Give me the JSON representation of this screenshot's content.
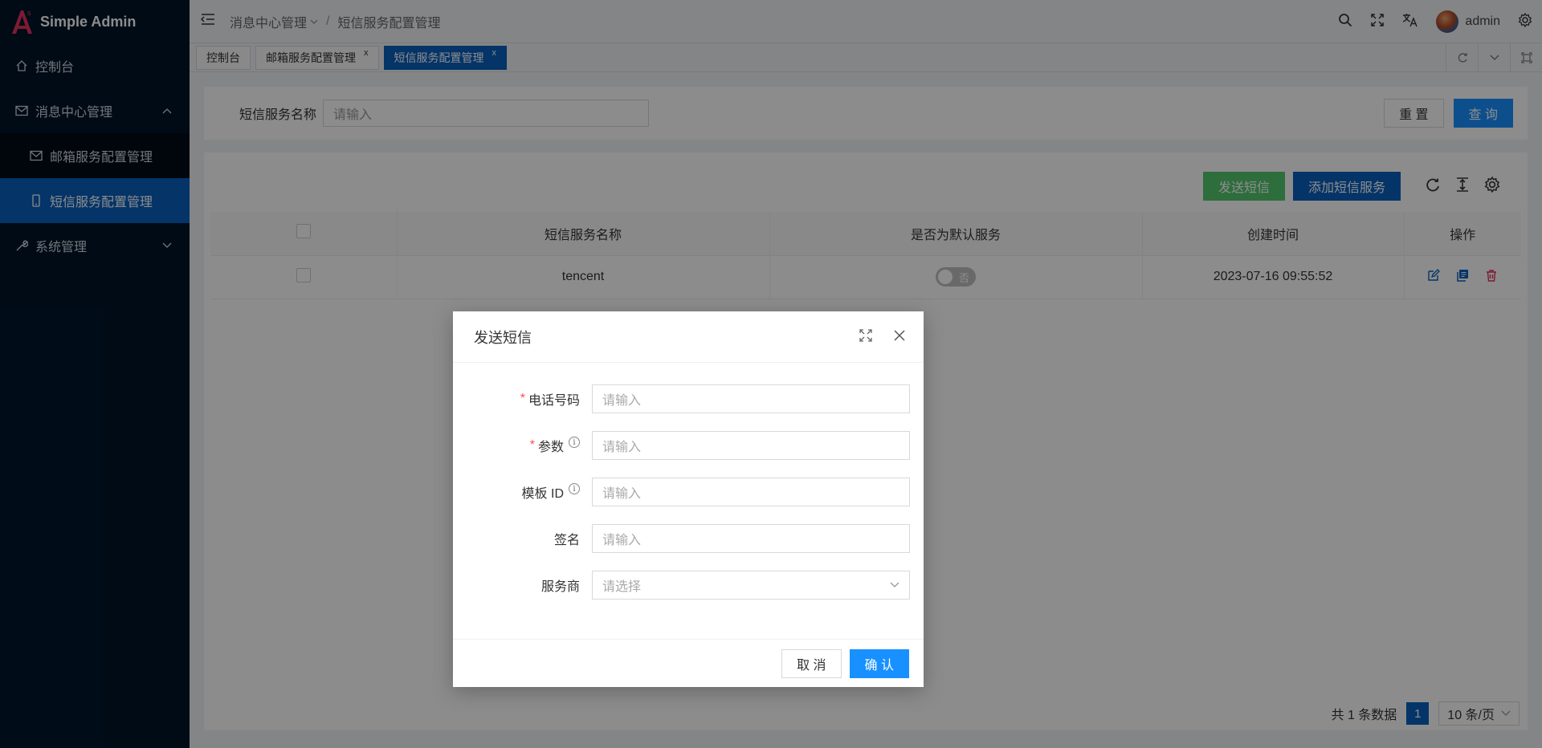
{
  "app": {
    "title": "Simple Admin"
  },
  "sidebar": {
    "items": [
      {
        "label": "控制台",
        "icon": "home-icon"
      },
      {
        "label": "消息中心管理",
        "icon": "mail-icon",
        "expanded": true,
        "children": [
          {
            "label": "邮箱服务配置管理",
            "icon": "mail-icon"
          },
          {
            "label": "短信服务配置管理",
            "icon": "phone-icon",
            "active": true
          }
        ]
      },
      {
        "label": "系统管理",
        "icon": "wrench-icon",
        "expanded": false
      }
    ]
  },
  "header": {
    "breadcrumb": [
      "消息中心管理",
      "短信服务配置管理"
    ],
    "user": "admin"
  },
  "tabs": [
    {
      "label": "控制台"
    },
    {
      "label": "邮箱服务配置管理",
      "close": "x"
    },
    {
      "label": "短信服务配置管理",
      "close": "x",
      "active": true
    }
  ],
  "search": {
    "label": "短信服务名称",
    "placeholder": "请输入",
    "reset_label": "重 置",
    "query_label": "查 询"
  },
  "toolbar": {
    "send_label": "发送短信",
    "add_label": "添加短信服务"
  },
  "table": {
    "columns": [
      "短信服务名称",
      "是否为默认服务",
      "创建时间",
      "操作"
    ],
    "rows": [
      {
        "name": "tencent",
        "default_label": "否",
        "default": false,
        "created": "2023-07-16 09:55:52"
      }
    ]
  },
  "pager": {
    "total": "共 1 条数据",
    "page": "1",
    "size": "10 条/页"
  },
  "modal": {
    "title": "发送短信",
    "fields": [
      {
        "label": "电话号码",
        "required": true,
        "info": false,
        "placeholder": "请输入"
      },
      {
        "label": "参数",
        "required": true,
        "info": true,
        "placeholder": "请输入"
      },
      {
        "label": "模板 ID",
        "required": false,
        "info": true,
        "placeholder": "请输入"
      },
      {
        "label": "签名",
        "required": false,
        "info": false,
        "placeholder": "请输入"
      },
      {
        "label": "服务商",
        "required": false,
        "info": false,
        "placeholder": "请选择",
        "type": "select"
      }
    ],
    "cancel_label": "取 消",
    "confirm_label": "确 认"
  },
  "colors": {
    "sidebar_bg": "#001529",
    "active_blue": "#0960bd",
    "primary": "#1890ff",
    "success": "#55c66e",
    "required": "#ff4d4f",
    "logo_accent": "#e2325e"
  }
}
